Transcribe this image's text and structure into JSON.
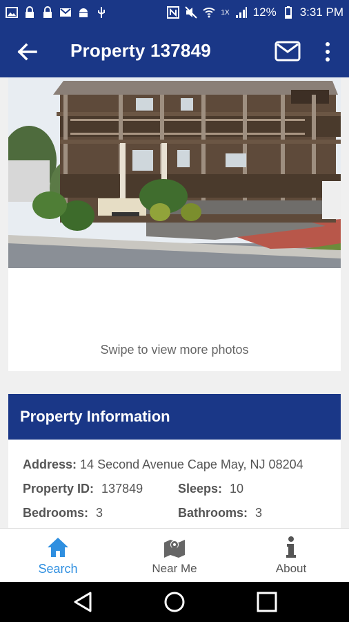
{
  "status_bar": {
    "battery": "12%",
    "time": "3:31 PM",
    "network": "1X"
  },
  "app_bar": {
    "title": "Property 137849",
    "back_icon": "arrow-left-icon",
    "mail_icon": "mail-icon",
    "more_icon": "more-vert-icon"
  },
  "photo": {
    "hint": "Swipe to view more photos"
  },
  "property_info": {
    "header": "Property Information",
    "address_label": "Address:",
    "address": "14 Second Avenue Cape May, NJ 08204",
    "id_label": "Property ID:",
    "id": "137849",
    "sleeps_label": "Sleeps:",
    "sleeps": "10",
    "bedrooms_label": "Bedrooms:",
    "bedrooms": "3",
    "bathrooms_label": "Bathrooms:",
    "bathrooms": "3"
  },
  "bottom_nav": {
    "items": [
      {
        "label": "Search",
        "icon": "home-icon",
        "active": true
      },
      {
        "label": "Near Me",
        "icon": "map-pin-icon",
        "active": false
      },
      {
        "label": "About",
        "icon": "info-icon",
        "active": false
      }
    ]
  },
  "colors": {
    "primary": "#1a3787",
    "accent": "#2f8fe0"
  }
}
